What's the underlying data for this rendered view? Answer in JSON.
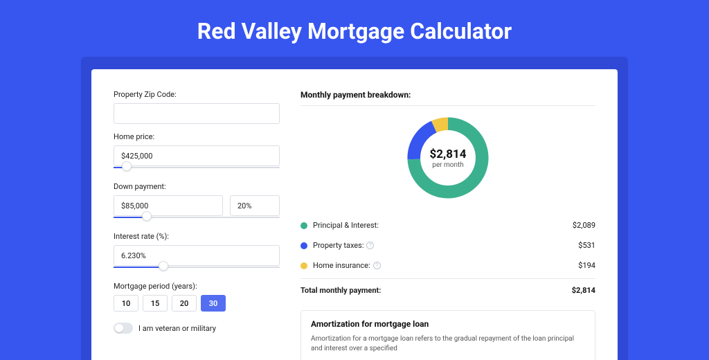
{
  "page": {
    "title": "Red Valley Mortgage Calculator"
  },
  "form": {
    "zip_label": "Property Zip Code:",
    "zip_value": "",
    "home_price_label": "Home price:",
    "home_price_value": "$425,000",
    "home_price_slider_pct": 8,
    "down_payment_label": "Down payment:",
    "down_payment_value": "$85,000",
    "down_payment_pct_value": "20%",
    "down_payment_slider_pct": 20,
    "interest_label": "Interest rate (%):",
    "interest_value": "6.230%",
    "interest_slider_pct": 30,
    "period_label": "Mortgage period (years):",
    "period_options": [
      "10",
      "15",
      "20",
      "30"
    ],
    "period_selected": "30",
    "veteran_label": "I am veteran or military"
  },
  "breakdown": {
    "heading": "Monthly payment breakdown:",
    "center_value": "$2,814",
    "center_sub": "per month",
    "items": [
      {
        "label": "Principal & Interest:",
        "value_text": "$2,089",
        "value": 2089,
        "color": "#3bb08f",
        "info": false
      },
      {
        "label": "Property taxes:",
        "value_text": "$531",
        "value": 531,
        "color": "#3755ef",
        "info": true
      },
      {
        "label": "Home insurance:",
        "value_text": "$194",
        "value": 194,
        "color": "#f2c744",
        "info": true
      }
    ],
    "total_label": "Total monthly payment:",
    "total_value": "$2,814"
  },
  "amortization": {
    "heading": "Amortization for mortgage loan",
    "text": "Amortization for a mortgage loan refers to the gradual repayment of the loan principal and interest over a specified"
  },
  "chart_data": {
    "type": "pie",
    "title": "Monthly payment breakdown",
    "series": [
      {
        "name": "Principal & Interest",
        "value": 2089,
        "color": "#3bb08f"
      },
      {
        "name": "Property taxes",
        "value": 531,
        "color": "#3755ef"
      },
      {
        "name": "Home insurance",
        "value": 194,
        "color": "#f2c744"
      }
    ],
    "total": 2814,
    "center_label": "$2,814 per month"
  }
}
